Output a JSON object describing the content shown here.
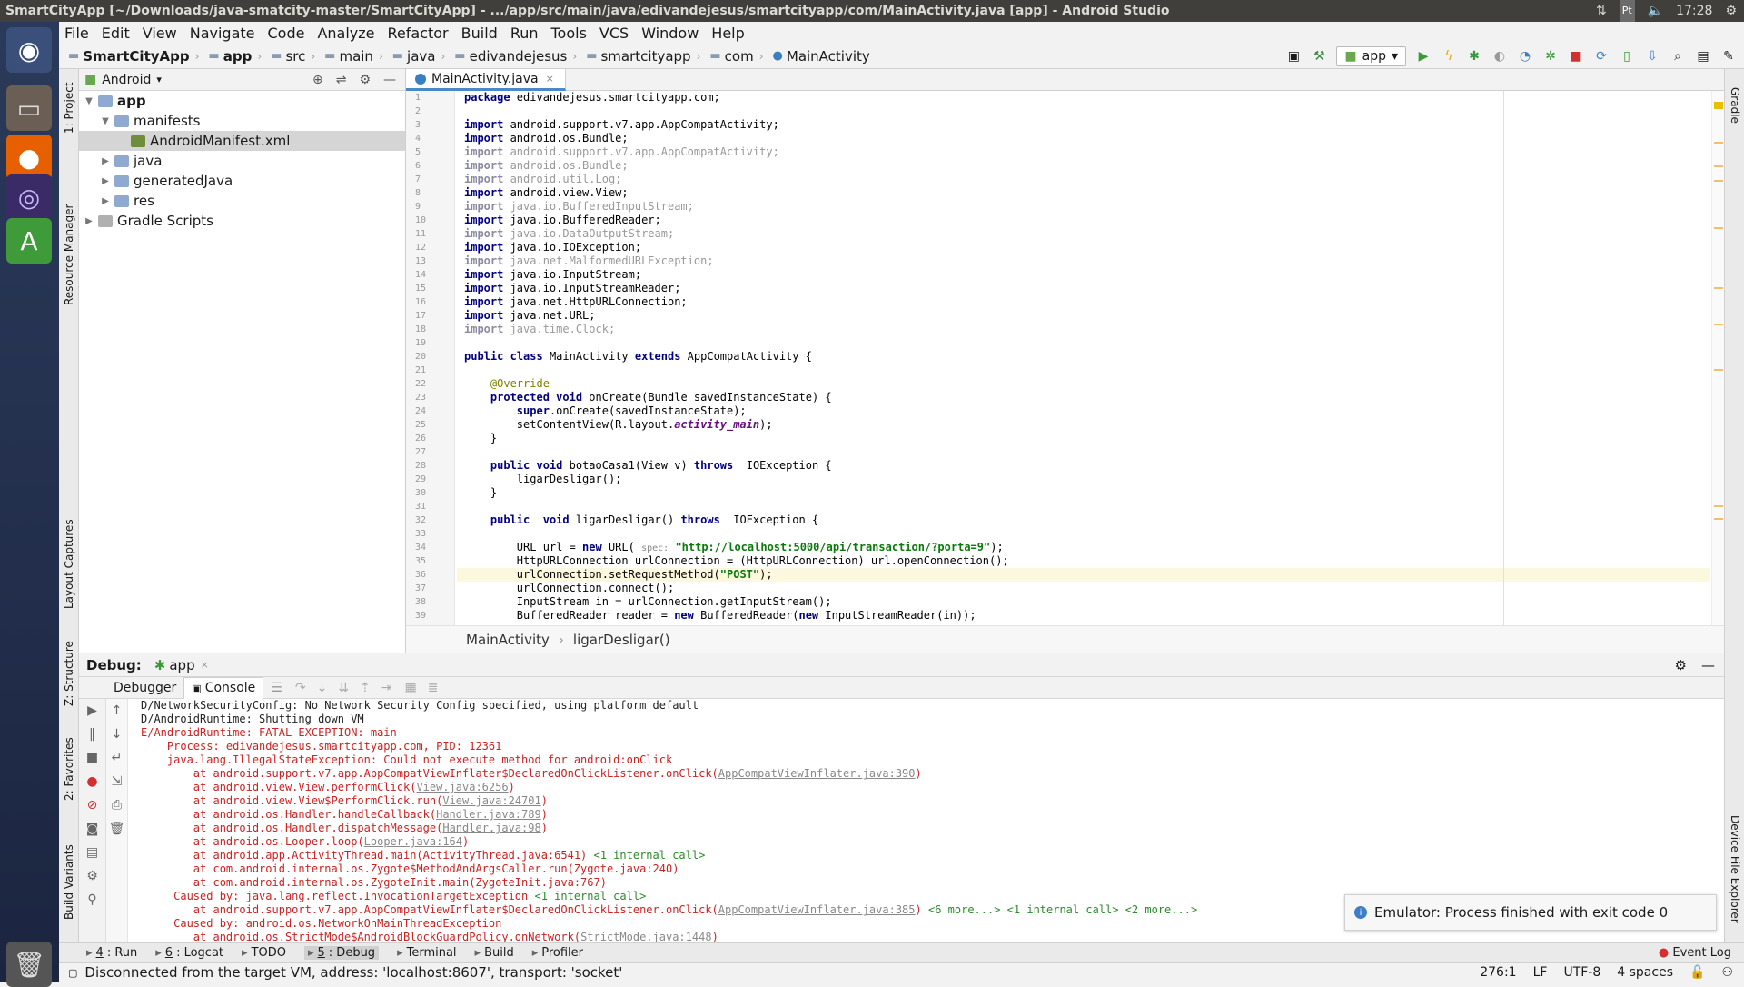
{
  "window": {
    "title": "SmartCityApp [~/Downloads/java-smatcity-master/SmartCityApp] - .../app/src/main/java/edivandejesus/smartcityapp/com/MainActivity.java [app] - Android Studio",
    "time": "17:28",
    "keyboard": "Pt"
  },
  "menu": [
    "File",
    "Edit",
    "View",
    "Navigate",
    "Code",
    "Analyze",
    "Refactor",
    "Build",
    "Run",
    "Tools",
    "VCS",
    "Window",
    "Help"
  ],
  "breadcrumb": [
    "SmartCityApp",
    "app",
    "src",
    "main",
    "java",
    "edivandejesus",
    "smartcityapp",
    "com",
    "MainActivity"
  ],
  "run_config": "app",
  "left_tabs": {
    "project": "1: Project",
    "resource": "Resource Manager",
    "layout": "Layout Captures",
    "structure": "Z: Structure",
    "favorites": "2: Favorites",
    "build_variants": "Build Variants"
  },
  "right_tabs": {
    "gradle": "Gradle",
    "device": "Device File Explorer"
  },
  "project": {
    "view": "Android",
    "tree": [
      {
        "label": "app",
        "level": 0,
        "arrow": "▼",
        "icon": "folder",
        "bold": true
      },
      {
        "label": "manifests",
        "level": 1,
        "arrow": "▼",
        "icon": "folder"
      },
      {
        "label": "AndroidManifest.xml",
        "level": 2,
        "arrow": "",
        "icon": "xml",
        "selected": true
      },
      {
        "label": "java",
        "level": 1,
        "arrow": "▶",
        "icon": "folder"
      },
      {
        "label": "generatedJava",
        "level": 1,
        "arrow": "▶",
        "icon": "folder"
      },
      {
        "label": "res",
        "level": 1,
        "arrow": "▶",
        "icon": "folder"
      },
      {
        "label": "Gradle Scripts",
        "level": 0,
        "arrow": "▶",
        "icon": "gradle"
      }
    ]
  },
  "editor": {
    "tab": "MainActivity.java",
    "current_line": 36,
    "lines": [
      "package edivandejesus.smartcityapp.com;",
      "",
      "import android.support.v7.app.AppCompatActivity;",
      "import android.os.Bundle;",
      "import android.support.v7.app.AppCompatActivity;",
      "import android.os.Bundle;",
      "import android.util.Log;",
      "import android.view.View;",
      "import java.io.BufferedInputStream;",
      "import java.io.BufferedReader;",
      "import java.io.DataOutputStream;",
      "import java.io.IOException;",
      "import java.net.MalformedURLException;",
      "import java.io.InputStream;",
      "import java.io.InputStreamReader;",
      "import java.net.HttpURLConnection;",
      "import java.net.URL;",
      "import java.time.Clock;",
      "",
      "public class MainActivity extends AppCompatActivity {",
      "",
      "    @Override",
      "    protected void onCreate(Bundle savedInstanceState) {",
      "        super.onCreate(savedInstanceState);",
      "        setContentView(R.layout.activity_main);",
      "    }",
      "",
      "    public void botaoCasa1(View v) throws  IOException {",
      "        ligarDesligar();",
      "    }",
      "",
      "    public  void ligarDesligar() throws  IOException {",
      "",
      "        URL url = new URL( spec: \"http://localhost:5000/api/transaction/?porta=9\");",
      "        HttpURLConnection urlConnection = (HttpURLConnection) url.openConnection();",
      "        urlConnection.setRequestMethod(\"POST\");",
      "        urlConnection.connect();",
      "        InputStream in = urlConnection.getInputStream();",
      "        BufferedReader reader = new BufferedReader(new InputStreamReader(in));"
    ],
    "crumbs": [
      "MainActivity",
      "ligarDesligar()"
    ]
  },
  "debug": {
    "label": "Debug:",
    "config": "app",
    "tabs": [
      "Debugger",
      "Console"
    ],
    "console": [
      {
        "t": "D/NetworkSecurityConfig: No Network Security Config specified, using platform default",
        "c": "norm"
      },
      {
        "t": "D/AndroidRuntime: Shutting down VM",
        "c": "norm"
      },
      {
        "t": "E/AndroidRuntime: FATAL EXCEPTION: main"
      },
      {
        "t": "    Process: edivandejesus.smartcityapp.com, PID: 12361"
      },
      {
        "t": "    java.lang.IllegalStateException: Could not execute method for android:onClick"
      },
      {
        "t": "        at android.support.v7.app.AppCompatViewInflater$DeclaredOnClickListener.onClick(",
        "l": "AppCompatViewInflater.java:390",
        "e": ")"
      },
      {
        "t": "        at android.view.View.performClick(",
        "l": "View.java:6256",
        "e": ")"
      },
      {
        "t": "        at android.view.View$PerformClick.run(",
        "l": "View.java:24701",
        "e": ")"
      },
      {
        "t": "        at android.os.Handler.handleCallback(",
        "l": "Handler.java:789",
        "e": ")"
      },
      {
        "t": "        at android.os.Handler.dispatchMessage(",
        "l": "Handler.java:98",
        "e": ")"
      },
      {
        "t": "        at android.os.Looper.loop(",
        "l": "Looper.java:164",
        "e": ")"
      },
      {
        "t": "        at android.app.ActivityThread.main(ActivityThread.java:6541) ",
        "m": "<1 internal call>"
      },
      {
        "t": "        at com.android.internal.os.Zygote$MethodAndArgsCaller.run(Zygote.java:240)"
      },
      {
        "t": "        at com.android.internal.os.ZygoteInit.main(ZygoteInit.java:767)"
      },
      {
        "t": "     Caused by: java.lang.reflect.InvocationTargetException ",
        "m": "<1 internal call>"
      },
      {
        "t": "        at android.support.v7.app.AppCompatViewInflater$DeclaredOnClickListener.onClick(",
        "l": "AppCompatViewInflater.java:385",
        "e": ") ",
        "m": "<6 more...> <1 internal call> <2 more...>"
      },
      {
        "t": "     Caused by: android.os.NetworkOnMainThreadException"
      },
      {
        "t": "        at android.os.StrictMode$AndroidBlockGuardPolicy.onNetwork(",
        "l": "StrictMode.java:1448",
        "e": ")"
      }
    ]
  },
  "notification": "Emulator: Process finished with exit code 0",
  "bottom_tabs": [
    {
      "n": "4",
      "l": ": Run"
    },
    {
      "n": "6",
      "l": ": Logcat"
    },
    {
      "n": "",
      "l": "TODO"
    },
    {
      "n": "5",
      "l": ": Debug",
      "sel": true
    },
    {
      "n": "",
      "l": "Terminal"
    },
    {
      "n": "",
      "l": "Build"
    },
    {
      "n": "",
      "l": "Profiler"
    }
  ],
  "event_log": "Event Log",
  "status": {
    "message": "Disconnected from the target VM, address: 'localhost:8607', transport: 'socket'",
    "position": "276:1",
    "line_sep": "LF",
    "encoding": "UTF-8",
    "indent": "4 spaces"
  }
}
